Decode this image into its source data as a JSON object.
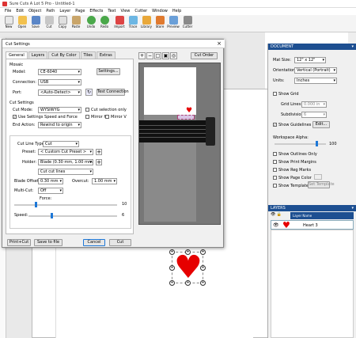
{
  "app": {
    "title": "Sure Cuts A Lot 5 Pro - Untitled-1"
  },
  "menu": [
    "File",
    "Edit",
    "Object",
    "Path",
    "Layer",
    "Page",
    "Effects",
    "Text",
    "View",
    "Cutter",
    "Window",
    "Help"
  ],
  "toolbar": [
    {
      "label": "New",
      "icon": "new-file-icon",
      "color": "#e8e8e8"
    },
    {
      "label": "Open",
      "icon": "folder-icon",
      "color": "#f2c14e"
    },
    {
      "label": "Save",
      "icon": "save-icon",
      "color": "#5a86c7"
    },
    {
      "label": "Cut",
      "icon": "scissors-icon",
      "color": "#c7c7c7"
    },
    {
      "label": "Copy",
      "icon": "copy-icon",
      "color": "#e0e0e0"
    },
    {
      "label": "Paste",
      "icon": "paste-icon",
      "color": "#c9a56a"
    },
    {
      "label": "Undo",
      "icon": "undo-icon",
      "color": "#4aa84a"
    },
    {
      "label": "Redo",
      "icon": "redo-icon",
      "color": "#4aa84a"
    },
    {
      "label": "Import",
      "icon": "import-icon",
      "color": "#d44"
    },
    {
      "label": "Trace",
      "icon": "trace-icon",
      "color": "#6cb6e3"
    },
    {
      "label": "Library",
      "icon": "library-icon",
      "color": "#e9a83a"
    },
    {
      "label": "Store",
      "icon": "store-icon",
      "color": "#e07a2f"
    },
    {
      "label": "Preview",
      "icon": "preview-icon",
      "color": "#6a9fd8"
    },
    {
      "label": "Cutter",
      "icon": "cutter-icon",
      "color": "#8a8a8a"
    }
  ],
  "dialog": {
    "title": "Cut Settings",
    "close": "×",
    "tabs": [
      "General",
      "Layers",
      "Cut By Color",
      "Tiles",
      "Extras"
    ],
    "mosaic_label": "Mosaic",
    "model_label": "Model:",
    "model_value": "CE-6040",
    "settings_btn": "Settings...",
    "connection_label": "Connection:",
    "connection_value": "USB",
    "port_label": "Port:",
    "port_value": "<Auto-Detect>",
    "test_btn": "Test Connection",
    "cut_settings_label": "Cut Settings",
    "cut_mode_label": "Cut Mode:",
    "cut_mode_value": "WYSIWYG",
    "cut_selection_only": "Cut selection only",
    "use_speed_force": "Use Settings Speed and Force",
    "mirror_h": "Mirror H",
    "mirror_v": "Mirror V",
    "end_action_label": "End Action:",
    "end_action_value": "Rewind to origin",
    "cut_line_type_label": "Cut Line Type:",
    "cut_line_type_value": "Cut",
    "preset_label": "Preset:",
    "preset_value": "< Custom Cut Preset >",
    "holder_label": "Holder:",
    "holder_value": "Blade (0.30 mm, 1.00 mm)",
    "cutline_value": "Cut cut lines",
    "blade_offset_label": "Blade Offset:",
    "blade_offset_value": "0.30 mm",
    "overcut_label": "Overcut:",
    "overcut_value": "1.00 mm",
    "multi_cut_label": "Multi-Cut:",
    "multi_cut_value": "Off",
    "force_label": "Force:",
    "force_value": "10",
    "force_level": 0.2,
    "speed_label": "Speed:",
    "speed_value": "6",
    "speed_level": 0.25,
    "cut_order_btn": "Cut Order",
    "print_cut_btn": "Print+Cut",
    "save_file_btn": "Save to file",
    "cancel_btn": "Cancel",
    "cut_btn": "Cut"
  },
  "document": {
    "header": "DOCUMENT",
    "mat_size_label": "Mat Size:",
    "mat_size_value": "12\" x 12\"",
    "orientation_label": "Orientation:",
    "orientation_value": "Vertical (Portrait)",
    "units_label": "Units:",
    "units_value": "Inches",
    "show_grid": "Show Grid",
    "grid_lines_label": "Grid Lines:",
    "grid_lines_value": "0.000 in",
    "subdivision_label": "Subdivision:",
    "subdivision_value": "6",
    "show_guidelines": "Show Guidelines",
    "edit_btn": "Edit...",
    "workspace_alpha_label": "Workspace Alpha:",
    "workspace_alpha_value": "100",
    "workspace_alpha_level": 0.8,
    "show_outlines": "Show Outlines Only",
    "show_print_margins": "Show Print Margins",
    "show_reg_marks": "Show Reg Marks",
    "show_page_color": "Show Page Color",
    "show_template": "Show Template",
    "set_template_btn": "Set Template"
  },
  "layers": {
    "header": "LAYERS",
    "col_name": "Layer Name",
    "layer_name": "Heart 3",
    "heart_color": "#e60000"
  },
  "colors": {
    "panel_header": "#1d4f91",
    "accent": "#1e78d7",
    "heart": "#e60000"
  }
}
